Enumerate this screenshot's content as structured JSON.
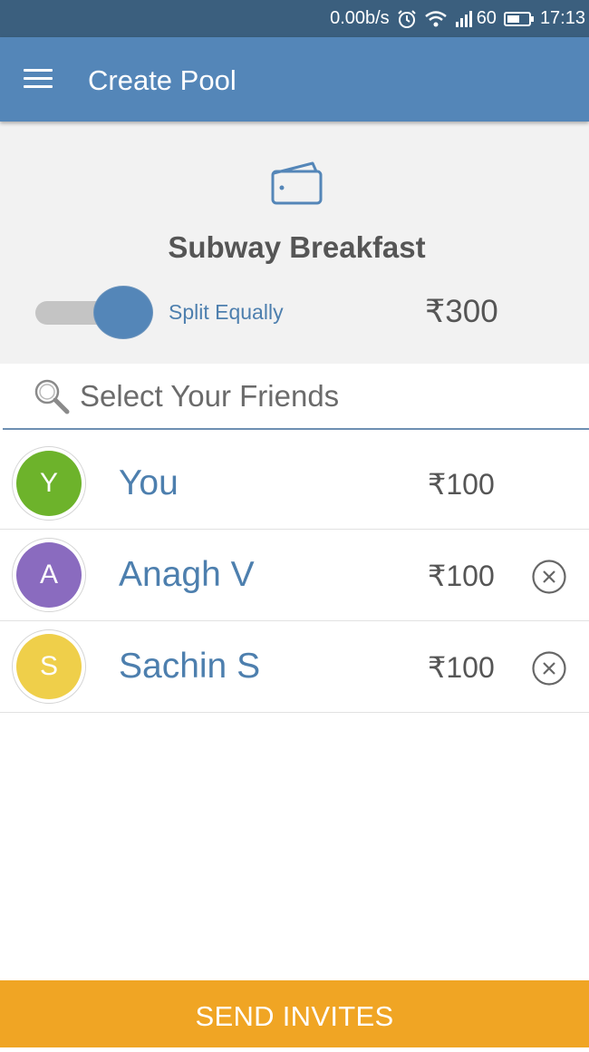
{
  "status_bar": {
    "net_speed": "0.00b/s",
    "signal_label": "60",
    "time": "17:13",
    "icons": [
      "alarm-icon",
      "wifi-icon",
      "signal-icon",
      "battery-icon"
    ]
  },
  "app_bar": {
    "title": "Create Pool",
    "menu_icon": "hamburger-menu-icon"
  },
  "pool": {
    "icon": "wallet-icon",
    "name": "Subway Breakfast",
    "split_toggle_on": true,
    "split_label": "Split Equally",
    "total": "₹300"
  },
  "search": {
    "icon": "search-icon",
    "placeholder": "Select Your Friends"
  },
  "friends": [
    {
      "initial": "Y",
      "name": "You",
      "amount": "₹100",
      "color": "#6db32b",
      "removable": false
    },
    {
      "initial": "A",
      "name": "Anagh V",
      "amount": "₹100",
      "color": "#8a6bbf",
      "removable": true
    },
    {
      "initial": "S",
      "name": "Sachin S",
      "amount": "₹100",
      "color": "#efcf4a",
      "removable": true
    }
  ],
  "send_button": {
    "label": "SEND INVITES",
    "color": "#f0a524"
  },
  "colors": {
    "primary": "#5486b8",
    "status_bar": "#3b5f7e",
    "panel_bg": "#f2f2f2"
  }
}
